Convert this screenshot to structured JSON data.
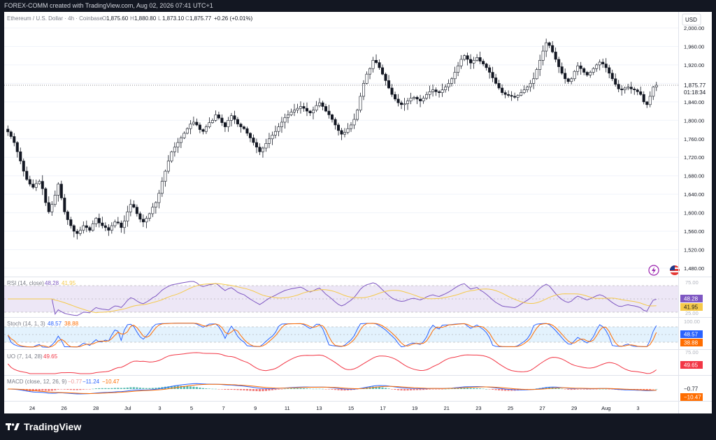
{
  "header": {
    "credit": "FOREX-COMM created with TradingView.com, Aug 02, 2026 07:41 UTC+1"
  },
  "symbol": {
    "name": "Ethereum / U.S. Dollar · 4h · Coinbase",
    "o_label": "O",
    "o": "1,875.60",
    "h_label": "H",
    "h": "1,880.80",
    "l_label": "L",
    "l": "1,873.10",
    "c_label": "C",
    "c": "1,875.77",
    "change": "+0.26 (+0.01%)"
  },
  "currency": "USD",
  "price_axis": {
    "labels": [
      "2,000.00",
      "1,960.00",
      "1,920.00",
      "1,880.00",
      "1,840.00",
      "1,800.00",
      "1,760.00",
      "1,720.00",
      "1,680.00",
      "1,640.00",
      "1,600.00",
      "1,560.00",
      "1,520.00",
      "1,480.00"
    ],
    "last_price": "1,875.77",
    "countdown": "01:18:34"
  },
  "time_axis": {
    "labels": [
      "24",
      "26",
      "28",
      "Jul",
      "3",
      "5",
      "7",
      "9",
      "11",
      "13",
      "15",
      "17",
      "19",
      "21",
      "23",
      "25",
      "27",
      "29",
      "Aug",
      "3"
    ]
  },
  "indicators": {
    "rsi": {
      "name": "RSI (14, close)",
      "v1": "48.28",
      "v2": "41.95",
      "axis": [
        "75.00",
        "25.00"
      ],
      "badge1": "48.28",
      "badge2": "41.95"
    },
    "stoch": {
      "name": "Stoch (14, 1, 3)",
      "v1": "48.57",
      "v2": "38.88",
      "axis": [
        "100.00"
      ],
      "badge1": "48.57",
      "badge2": "38.88"
    },
    "uo": {
      "name": "UO (7, 14, 28)",
      "v1": "49.65",
      "axis": [
        "75.00"
      ],
      "badge1": "49.65"
    },
    "macd": {
      "name": "MACD (close, 12, 26, 9)",
      "v1": "−0.77",
      "v2": "−11.24",
      "v3": "−10.47",
      "badge1": "−0.77",
      "badge2": "−10.47"
    }
  },
  "footer": {
    "brand": "TradingView"
  },
  "colors": {
    "rsi": "#7e57c2",
    "rsi_ma": "#f5c94a",
    "stoch_k": "#2962ff",
    "stoch_d": "#ff6d00",
    "uo": "#f23645",
    "macd": "#2962ff",
    "signal": "#ff6d00"
  },
  "chart_data": {
    "type": "candlestick",
    "timeframe": "4h",
    "ylim": [
      1480,
      2000
    ],
    "closes": [
      1775,
      1765,
      1752,
      1732,
      1712,
      1690,
      1672,
      1662,
      1655,
      1663,
      1668,
      1652,
      1622,
      1602,
      1618,
      1638,
      1662,
      1632,
      1602,
      1585,
      1572,
      1560,
      1555,
      1562,
      1572,
      1568,
      1562,
      1576,
      1588,
      1578,
      1572,
      1568,
      1562,
      1572,
      1580,
      1578,
      1568,
      1582,
      1602,
      1618,
      1612,
      1598,
      1586,
      1580,
      1588,
      1598,
      1612,
      1622,
      1642,
      1668,
      1690,
      1712,
      1732,
      1742,
      1752,
      1762,
      1772,
      1782,
      1792,
      1796,
      1790,
      1780,
      1776,
      1786,
      1795,
      1800,
      1812,
      1805,
      1795,
      1786,
      1800,
      1810,
      1802,
      1792,
      1786,
      1782,
      1772,
      1762,
      1752,
      1742,
      1732,
      1740,
      1750,
      1760,
      1768,
      1776,
      1786,
      1796,
      1806,
      1812,
      1818,
      1822,
      1826,
      1830,
      1826,
      1820,
      1816,
      1822,
      1832,
      1838,
      1830,
      1820,
      1812,
      1802,
      1790,
      1778,
      1770,
      1774,
      1782,
      1790,
      1802,
      1822,
      1852,
      1880,
      1900,
      1912,
      1930,
      1925,
      1914,
      1900,
      1886,
      1870,
      1856,
      1846,
      1838,
      1834,
      1836,
      1842,
      1848,
      1850,
      1846,
      1842,
      1848,
      1856,
      1862,
      1866,
      1862,
      1860,
      1866,
      1872,
      1880,
      1890,
      1904,
      1918,
      1932,
      1940,
      1932,
      1924,
      1930,
      1936,
      1928,
      1922,
      1914,
      1904,
      1892,
      1880,
      1870,
      1860,
      1856,
      1854,
      1852,
      1850,
      1854,
      1860,
      1866,
      1872,
      1880,
      1890,
      1910,
      1930,
      1950,
      1968,
      1962,
      1948,
      1932,
      1916,
      1902,
      1890,
      1884,
      1890,
      1906,
      1918,
      1912,
      1904,
      1898,
      1904,
      1912,
      1920,
      1926,
      1922,
      1914,
      1902,
      1890,
      1878,
      1868,
      1866,
      1870,
      1872,
      1868,
      1866,
      1862,
      1856,
      1840,
      1834,
      1852,
      1872,
      1876
    ]
  }
}
